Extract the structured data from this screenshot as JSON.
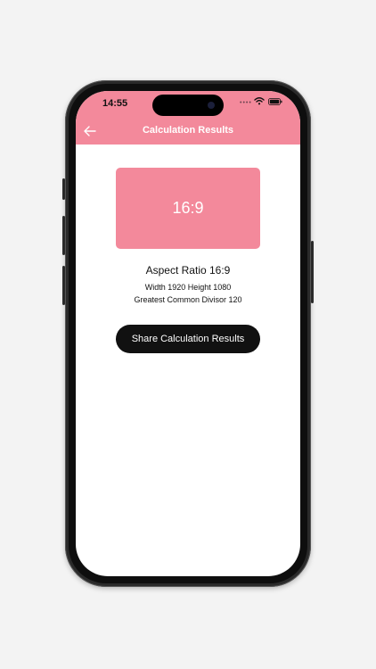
{
  "status_bar": {
    "time": "14:55",
    "signal_dots": "••••",
    "wifi_icon": "wifi-icon",
    "battery_icon": "battery-icon"
  },
  "nav": {
    "back_icon": "arrow-left-icon",
    "title": "Calculation Results"
  },
  "result": {
    "ratio_display": "16:9",
    "aspect_ratio_label": "Aspect Ratio 16:9",
    "dimensions_label": "Width 1920 Height 1080",
    "gcd_label": "Greatest Common Divisor 120"
  },
  "actions": {
    "share_label": "Share Calculation Results"
  },
  "colors": {
    "accent": "#f3899b",
    "button_bg": "#111111",
    "background": "#f3f3f3"
  }
}
